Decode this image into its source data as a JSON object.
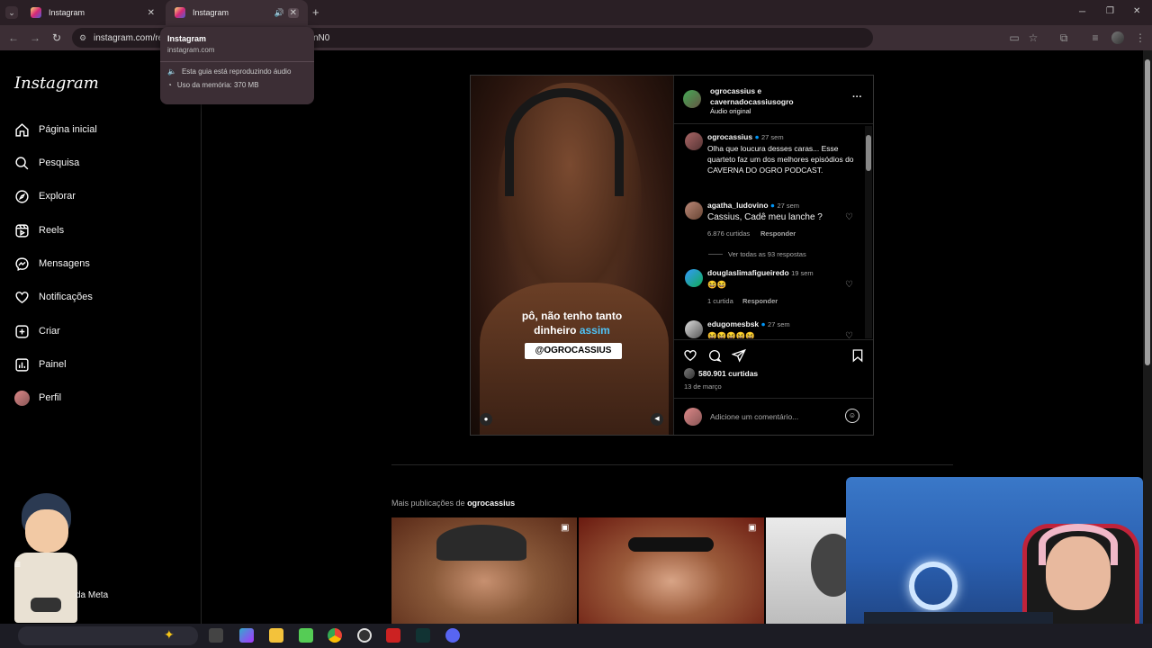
{
  "browser": {
    "tabs": [
      {
        "title": "Instagram"
      },
      {
        "title": "Instagram"
      }
    ],
    "new_tab": "+",
    "url": "instagram.com/re",
    "url_tail": "nN0",
    "hover_card": {
      "title": "Instagram",
      "domain": "instagram.com",
      "audio": "Esta guia está reproduzindo áudio",
      "memory": "Uso da memória: 370 MB"
    }
  },
  "sidebar": {
    "logo": "Instagram",
    "items": [
      {
        "label": "Página inicial",
        "icon": "home-icon"
      },
      {
        "label": "Pesquisa",
        "icon": "search-icon"
      },
      {
        "label": "Explorar",
        "icon": "compass-icon"
      },
      {
        "label": "Reels",
        "icon": "reels-icon"
      },
      {
        "label": "Mensagens",
        "icon": "messenger-icon"
      },
      {
        "label": "Notificações",
        "icon": "heart-icon"
      },
      {
        "label": "Criar",
        "icon": "plus-square-icon"
      },
      {
        "label": "Painel",
        "icon": "dashboard-icon"
      },
      {
        "label": "Perfil",
        "icon": "avatar-icon"
      }
    ],
    "meta_label": "da Meta"
  },
  "post": {
    "video_caption_line1": "pô, não tenho tanto",
    "video_caption_line2": "dinheiro",
    "video_caption_highlight": "assim",
    "video_tag": "@OGROCASSIUS",
    "author_line1": "ogrocassius e",
    "author_line2": "cavernadocassiusogro",
    "audio": "Áudio original",
    "more": "···",
    "comments": [
      {
        "user": "ogrocassius",
        "time": "27 sem",
        "text": "Olha que loucura desses caras... Esse quarteto faz um dos melhores episódios do CAVERNA DO OGRO PODCAST.",
        "likes": "",
        "reply": ""
      },
      {
        "user": "agatha_ludovino",
        "time": "27 sem",
        "text": "Cassius, Cadê meu lanche ?",
        "likes": "6.876 curtidas",
        "reply": "Responder"
      },
      {
        "user": "douglaslimafigueiredo",
        "time": "19 sem",
        "text": "😆😆",
        "likes": "1 curtida",
        "reply": "Responder"
      },
      {
        "user": "edugomesbsk",
        "time": "27 sem",
        "text": "😆😆😆😆😆",
        "likes": "",
        "reply": ""
      }
    ],
    "view_replies": "Ver todas as 93 respostas",
    "likes": "580.901 curtidas",
    "date": "13 de março",
    "comment_placeholder": "Adicione um comentário..."
  },
  "more_posts": {
    "label_prefix": "Mais publicações de",
    "label_user": "ogrocassius"
  },
  "colors": {
    "background": "#000000",
    "verified": "#0095f6",
    "highlight": "#4fc3f7",
    "tab_bar": "#2a1f25"
  }
}
